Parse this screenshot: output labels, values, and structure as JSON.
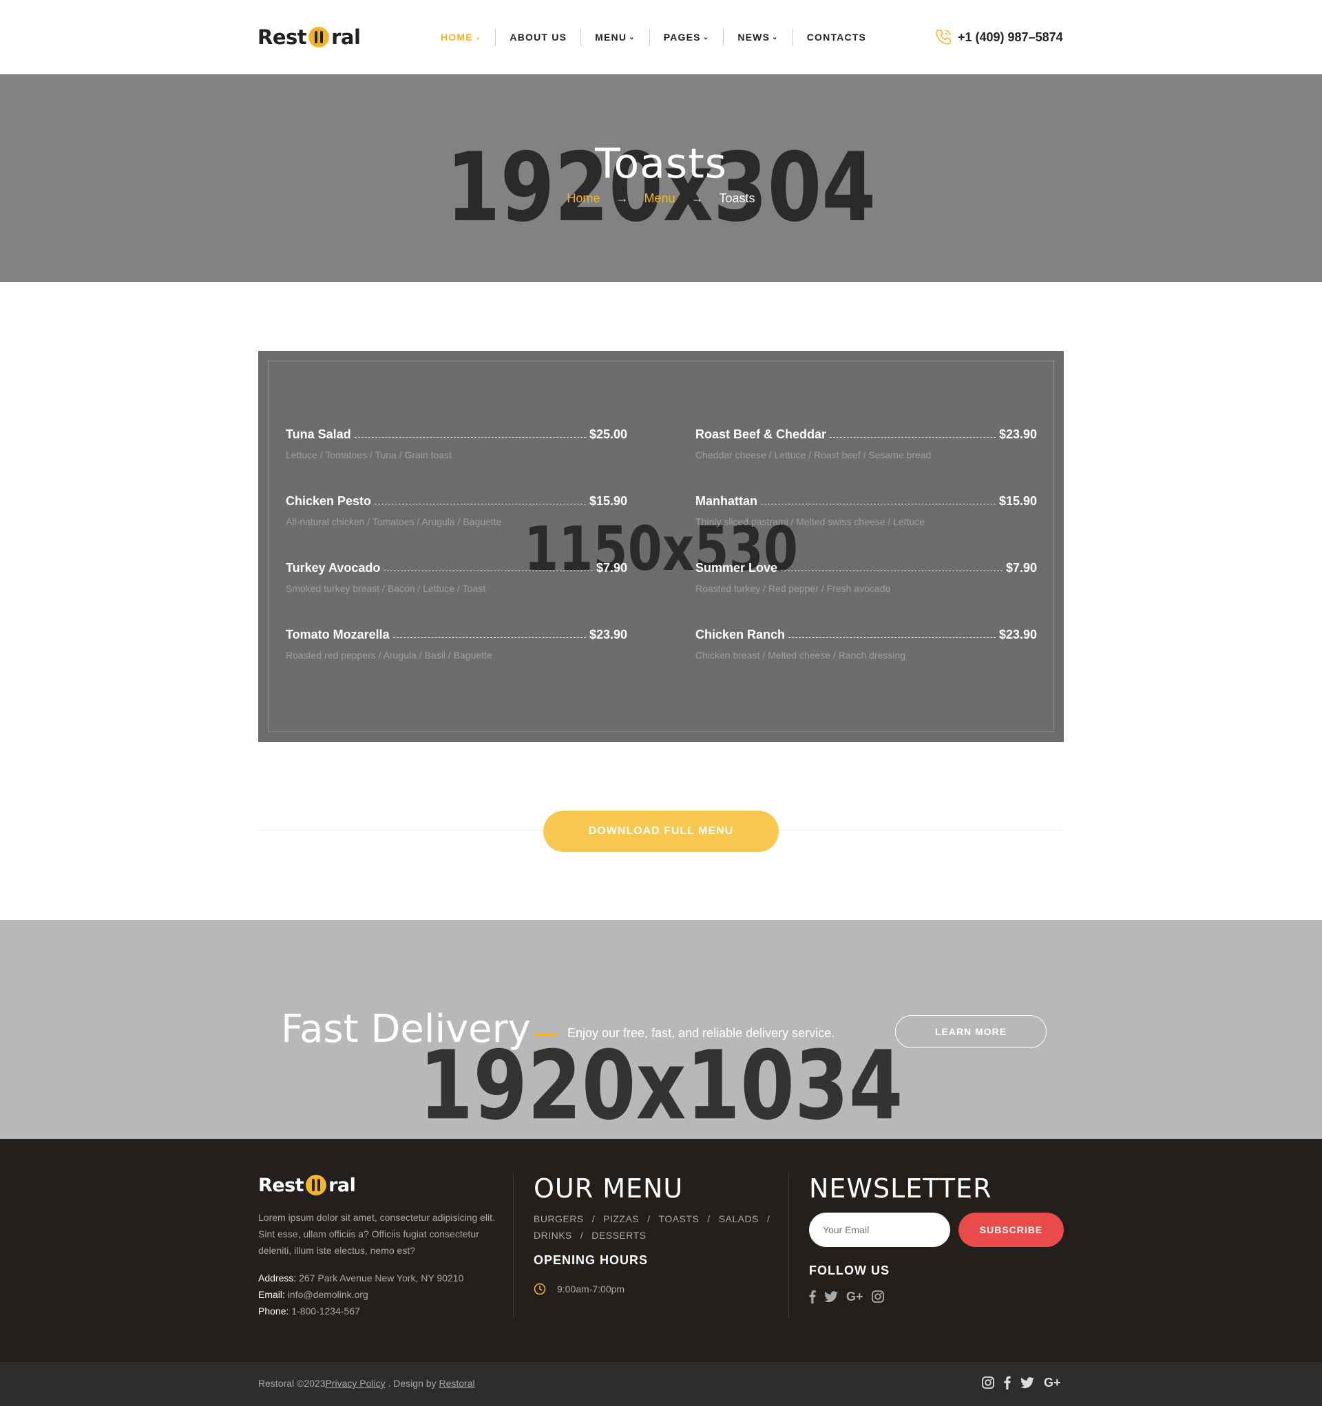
{
  "header": {
    "logo_left": "Rest",
    "logo_right": "ral",
    "nav": [
      {
        "label": "HOME",
        "dropdown": true,
        "active": true
      },
      {
        "label": "ABOUT US",
        "dropdown": false,
        "active": false
      },
      {
        "label": "MENU",
        "dropdown": true,
        "active": false
      },
      {
        "label": "PAGES",
        "dropdown": true,
        "active": false
      },
      {
        "label": "NEWS",
        "dropdown": true,
        "active": false
      },
      {
        "label": "CONTACTS",
        "dropdown": false,
        "active": false
      }
    ],
    "phone": "+1 (409) 987–5874",
    "phone_icon": "phone-icon"
  },
  "hero": {
    "placeholder": "1920x304",
    "title": "Toasts",
    "breadcrumb": {
      "home": "Home",
      "menu": "Menu",
      "current": "Toasts",
      "arrow": "→"
    }
  },
  "menu": {
    "placeholder": "1150x530",
    "items": [
      {
        "name": "Tuna Salad",
        "price": "$25.00",
        "desc": "Lettuce / Tomatoes / Tuna / Grain toast"
      },
      {
        "name": "Roast Beef & Cheddar",
        "price": "$23.90",
        "desc": "Cheddar cheese / Lettuce / Roast beef / Sesame bread"
      },
      {
        "name": "Chicken Pesto",
        "price": "$15.90",
        "desc": "All-natural chicken / Tomatoes / Arugula / Baguette"
      },
      {
        "name": "Manhattan",
        "price": "$15.90",
        "desc": "Thinly sliced pastrami / Melted swiss cheese / Lettuce"
      },
      {
        "name": "Turkey Avocado",
        "price": "$7.90",
        "desc": "Smoked turkey breast / Bacon / Lettuce / Toast"
      },
      {
        "name": "Summer Love",
        "price": "$7.90",
        "desc": "Roasted turkey / Red pepper / Fresh avocado"
      },
      {
        "name": "Tomato Mozarella",
        "price": "$23.90",
        "desc": "Roasted red peppers / Arugula / Basil / Baguette"
      },
      {
        "name": "Chicken Ranch",
        "price": "$23.90",
        "desc": "Chicken breast / Melted cheese / Ranch dressing"
      }
    ],
    "download_label": "DOWNLOAD FULL MENU"
  },
  "delivery": {
    "placeholder": "1920x1034",
    "title": "Fast Delivery",
    "subtitle": "Enjoy our free, fast, and reliable delivery service.",
    "button": "LEARN MORE"
  },
  "footer": {
    "logo_left": "Rest",
    "logo_right": "ral",
    "about": "Lorem ipsum dolor sit amet, consectetur adipisicing elit. Sint esse, ullam officiis a? Officiis fugiat consectetur deleniti, illum iste electus, nemo est?",
    "address_label": "Address:",
    "address": "267 Park Avenue New York, NY 90210",
    "email_label": "Email:",
    "email": "info@demolink.org",
    "phone_label": "Phone:",
    "phone": "1-800-1234-567",
    "menu_heading": "OUR MENU",
    "categories": [
      "BURGERS",
      "PIZZAS",
      "TOASTS",
      "SALADS",
      "DRINKS",
      "DESSERTS"
    ],
    "hours_heading": "OPENING HOURS",
    "hours": "9:00am-7:00pm",
    "newsletter_heading": "NEWSLETTER",
    "email_placeholder": "Your Email",
    "subscribe": "SUBSCRIBE",
    "follow": "FOLLOW US",
    "social_icons": [
      "facebook-icon",
      "twitter-icon",
      "google-plus-icon",
      "instagram-icon"
    ]
  },
  "bottom": {
    "copyright": "Restoral ©2023",
    "privacy": "Privacy Policy",
    "design_by": " . Design by ",
    "designer": " Restoral",
    "social_icons": [
      "instagram-icon",
      "facebook-icon",
      "twitter-icon",
      "google-plus-icon"
    ]
  },
  "colors": {
    "accent": "#f5b426",
    "button_yellow": "#f9c74f",
    "subscribe_red": "#e94b4b",
    "footer_bg": "#231f1d"
  }
}
